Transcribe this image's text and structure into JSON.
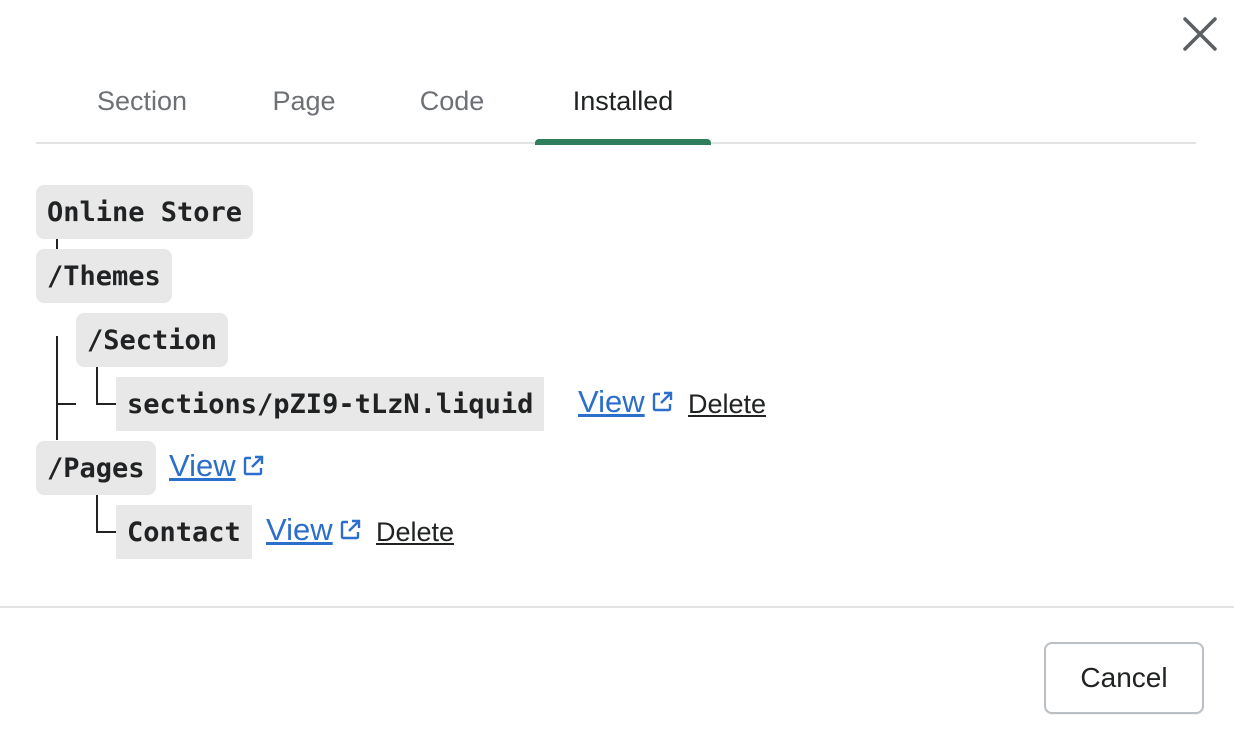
{
  "tabs": [
    {
      "label": "Section"
    },
    {
      "label": "Page"
    },
    {
      "label": "Code"
    },
    {
      "label": "Installed",
      "active": true
    }
  ],
  "tree": {
    "root": "Online Store",
    "themes": "/Themes",
    "section": "/Section",
    "section_file": "sections/pZI9-tLzN.liquid",
    "pages": "/Pages",
    "contact": "Contact"
  },
  "actions": {
    "view_label": "View",
    "delete_label": "Delete"
  },
  "footer": {
    "cancel_label": "Cancel"
  },
  "colors": {
    "accent": "#2e7d5b",
    "link": "#2c6ecb",
    "node_bg": "#e8e8e8"
  },
  "icons": {
    "close": "close-icon",
    "external": "external-link-icon"
  }
}
